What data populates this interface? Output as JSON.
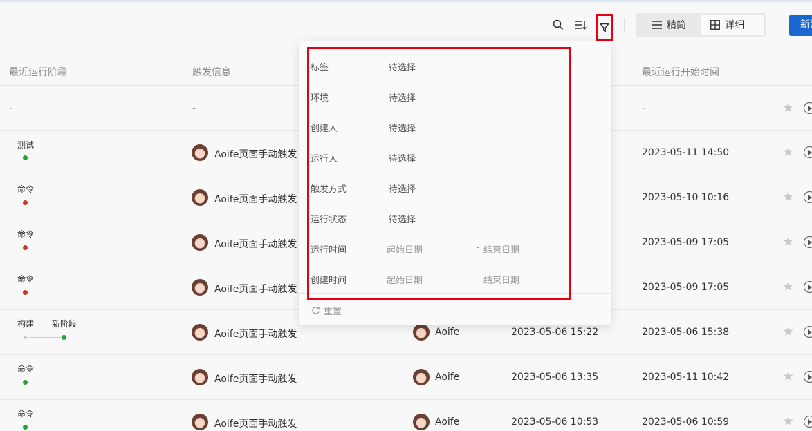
{
  "toolbar": {
    "view_compact": "精简",
    "view_detail": "详细",
    "new_button": "新建"
  },
  "table": {
    "headers": [
      "最近运行阶段",
      "触发信息",
      "最近运行开始时间"
    ],
    "rows": [
      {
        "stage1": "",
        "stage2": "",
        "trigger": "-",
        "runner": "",
        "create_time": "",
        "start_time": "-",
        "stage_dash": "-"
      },
      {
        "stage1": "测试",
        "stage2": "",
        "trigger": "Aoife页面手动触发",
        "runner": "",
        "create_time": "",
        "start_time": "2023-05-11 14:50"
      },
      {
        "stage1": "命令",
        "stage2": "",
        "trigger": "Aoife页面手动触发",
        "runner": "",
        "create_time": "",
        "start_time": "2023-05-10 10:16"
      },
      {
        "stage1": "命令",
        "stage2": "",
        "trigger": "Aoife页面手动触发",
        "runner": "",
        "create_time": "",
        "start_time": "2023-05-09 17:05"
      },
      {
        "stage1": "命令",
        "stage2": "",
        "trigger": "Aoife页面手动触发",
        "runner": "",
        "create_time": "",
        "start_time": "2023-05-09 17:05"
      },
      {
        "stage1": "构建",
        "stage2": "新阶段",
        "trigger": "Aoife页面手动触发",
        "runner": "Aoife",
        "create_time": "2023-05-06 15:22",
        "start_time": "2023-05-06 15:38"
      },
      {
        "stage1": "命令",
        "stage2": "",
        "trigger": "Aoife页面手动触发",
        "runner": "Aoife",
        "create_time": "2023-05-06 13:35",
        "start_time": "2023-05-11 10:42"
      },
      {
        "stage1": "命令",
        "stage2": "",
        "trigger": "Aoife页面手动触发",
        "runner": "Aoife",
        "create_time": "2023-05-06 10:53",
        "start_time": "2023-05-06 10:59"
      }
    ]
  },
  "filter": {
    "tags": {
      "label": "标签",
      "value": "待选择"
    },
    "env": {
      "label": "环境",
      "value": "待选择"
    },
    "creator": {
      "label": "创建人",
      "value": "待选择"
    },
    "runner": {
      "label": "运行人",
      "value": "待选择"
    },
    "trigger": {
      "label": "触发方式",
      "value": "待选择"
    },
    "status": {
      "label": "运行状态",
      "value": "待选择"
    },
    "run_time": {
      "label": "运行时间",
      "start": "起始日期",
      "sep": "-",
      "end": "结束日期"
    },
    "create_time": {
      "label": "创建时间",
      "start": "起始日期",
      "sep": "-",
      "end": "结束日期"
    },
    "reset": "重置"
  },
  "colors": {
    "accent": "#1a67d2",
    "success": "#22a33a",
    "error": "#d93025",
    "highlight": "#e60012"
  }
}
